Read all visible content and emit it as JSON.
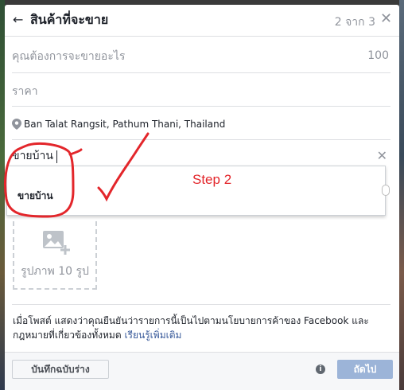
{
  "header": {
    "title": "สินค้าที่จะขาย",
    "step_counter": "2 จาก 3"
  },
  "fields": {
    "item_placeholder": "คุณต้องการจะขายอะไร",
    "quantity": "100",
    "price_placeholder": "ราคา",
    "location": "Ban Talat Rangsit, Pathum Thani, Thailand",
    "category_value": "ขายบ้าน"
  },
  "dropdown": {
    "items": [
      "ขายบ้าน"
    ]
  },
  "photo": {
    "label": "รูปภาพ 10 รูป"
  },
  "policy": {
    "text": "เมื่อโพสต์ แสดงว่าคุณยืนยันว่ารายการนี้เป็นไปตามนโยบายการค้าของ Facebook และกฎหมายที่เกี่ยวข้องทั้งหมด",
    "link": "เรียนรู้เพิ่มเติม"
  },
  "footer": {
    "save_draft": "บันทึกฉบับร่าง",
    "next": "ถัดไป"
  },
  "annotation": {
    "step_label": "Step 2",
    "color": "#e3262b"
  },
  "colors": {
    "primary_disabled": "#9cb4d8",
    "link": "#365899",
    "muted_text": "#90949c",
    "border": "#dddfe2"
  },
  "icons": [
    "back-arrow-icon",
    "close-icon",
    "location-pin-icon",
    "clear-icon",
    "photo-add-icon",
    "info-icon"
  ]
}
